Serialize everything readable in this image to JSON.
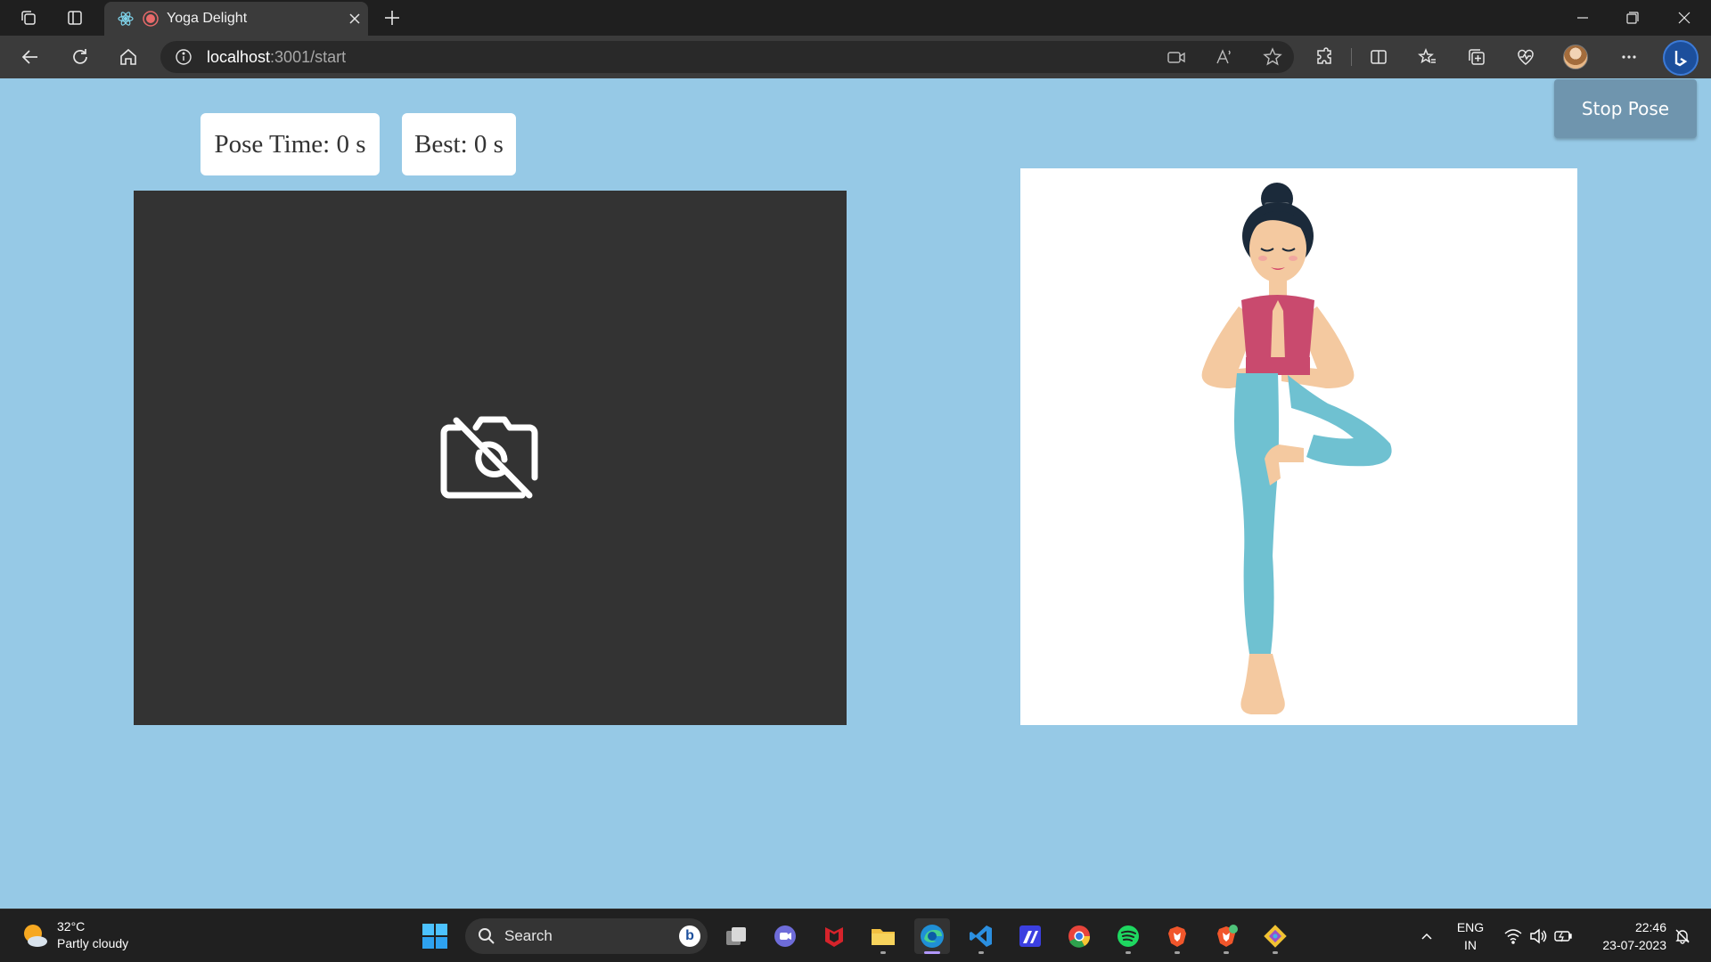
{
  "browser": {
    "tab_title": "Yoga Delight",
    "url_host": "localhost",
    "url_path": ":3001/start"
  },
  "page": {
    "pose_time_label": "Pose Time: 0 s",
    "best_label": "Best: 0 s",
    "stop_button_label": "Stop Pose",
    "colors": {
      "background": "#96c9e6",
      "webcam_bg": "#333333",
      "stop_button": "#6f95ae"
    },
    "icons": {
      "webcam_placeholder": "camera-off-icon",
      "pose_image": "tree-pose-illustration"
    }
  },
  "taskbar": {
    "weather_temp": "32°C",
    "weather_desc": "Partly cloudy",
    "search_placeholder": "Search",
    "language_line1": "ENG",
    "language_line2": "IN",
    "time": "22:46",
    "date": "23-07-2023"
  }
}
